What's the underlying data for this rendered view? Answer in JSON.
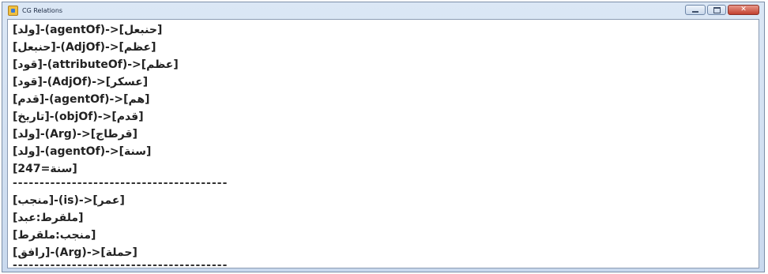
{
  "window": {
    "title": "CG Relations"
  },
  "lines": [
    "[حنبعل]<-(agentOf)-[ولد]",
    "[عظم]<-(AdjOf)-[حنبعل]",
    "[عظم]<-(attributeOf)-[قود]",
    "[عسكر]<-(AdjOf)-[قود]",
    "[هم]<-(agentOf)-[قدم]",
    "[قدم]<-(objOf)-[تاريخ]",
    "[قرطاج]<-(Arg)-[ولد]",
    "[سنة]<-(agentOf)-[ولد]",
    "[سنة=247]",
    "----------------------------------------",
    "[عمر]<-(is)-[منجب]",
    "[ملقرط:عبد]",
    "[منجب:ملقرط]",
    "[حملة]<-(Arg)-[رافق]",
    "----------------------------------------"
  ]
}
